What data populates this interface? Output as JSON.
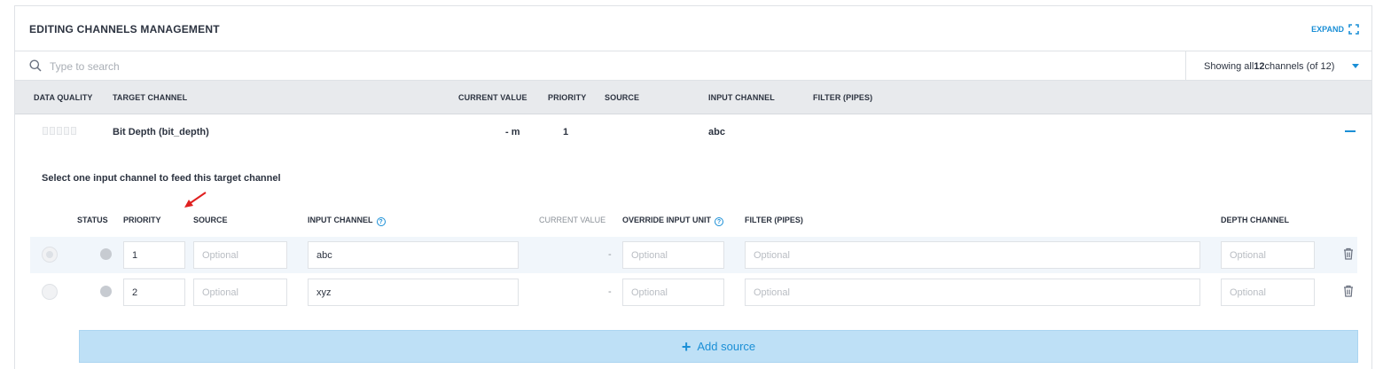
{
  "header": {
    "title": "EDITING CHANNELS MANAGEMENT",
    "expand_label": "EXPAND"
  },
  "search": {
    "placeholder": "Type to search",
    "showing_prefix": "Showing all ",
    "showing_count": "12",
    "showing_suffix": " channels (of 12)"
  },
  "columns": {
    "data_quality": "DATA QUALITY",
    "target_channel": "TARGET CHANNEL",
    "current_value": "CURRENT VALUE",
    "priority": "PRIORITY",
    "source": "SOURCE",
    "input_channel": "INPUT CHANNEL",
    "filter": "FILTER (PIPES)"
  },
  "channel": {
    "name": "Bit Depth (bit_depth)",
    "current_value": "- m",
    "priority": "1",
    "input_channel": "abc"
  },
  "instruction": "Select one input channel to feed this target channel",
  "sub_columns": {
    "status": "STATUS",
    "priority": "PRIORITY",
    "source": "SOURCE",
    "input_channel": "INPUT CHANNEL",
    "current_value": "CURRENT VALUE",
    "override_unit": "OVERRIDE INPUT UNIT",
    "filter": "FILTER (PIPES)",
    "depth_channel": "DEPTH CHANNEL"
  },
  "sources": [
    {
      "priority": "1",
      "input_channel": "abc",
      "current_value": "-",
      "source_placeholder": "Optional",
      "override_placeholder": "Optional",
      "filter_placeholder": "Optional",
      "depth_placeholder": "Optional",
      "selected": true
    },
    {
      "priority": "2",
      "input_channel": "xyz",
      "current_value": "-",
      "source_placeholder": "Optional",
      "override_placeholder": "Optional",
      "filter_placeholder": "Optional",
      "depth_placeholder": "Optional",
      "selected": false
    }
  ],
  "add_source_label": "Add source",
  "colors": {
    "accent": "#1b8fd6",
    "annotation_arrow": "#e02020",
    "add_source_bg": "#bee0f6",
    "highlight_row": "#f1f6fb"
  },
  "icons": [
    "expand-icon",
    "search-icon",
    "caret-down-icon",
    "collapse-icon",
    "help-icon",
    "trash-icon",
    "plus-icon",
    "arrow-annotation-icon"
  ]
}
